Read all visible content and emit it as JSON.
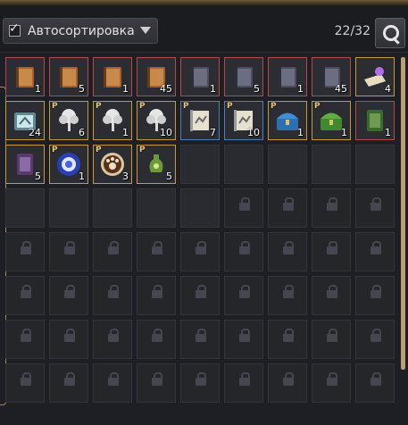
{
  "header": {
    "auto_sort_label": "Автосортировка",
    "auto_sort_checked": true,
    "capacity_text": "22/32"
  },
  "colors": {
    "rare_red": "#b34a4a",
    "rare_blue": "#4b7fb6",
    "rare_gold": "#c49a3a",
    "scroll_thumb": "#b9a073"
  },
  "items": [
    {
      "icon": "brown-book-icon",
      "qty": "1",
      "rarity": "red",
      "p": false
    },
    {
      "icon": "brown-book-icon",
      "qty": "5",
      "rarity": "red",
      "p": false
    },
    {
      "icon": "brown-book-icon",
      "qty": "1",
      "rarity": "red",
      "p": false
    },
    {
      "icon": "brown-book-icon",
      "qty": "45",
      "rarity": "red",
      "p": false
    },
    {
      "icon": "dark-book-icon",
      "qty": "1",
      "rarity": "red",
      "p": false
    },
    {
      "icon": "dark-book-icon",
      "qty": "5",
      "rarity": "red",
      "p": false
    },
    {
      "icon": "dark-book-icon",
      "qty": "1",
      "rarity": "red",
      "p": false
    },
    {
      "icon": "dark-book-icon",
      "qty": "45",
      "rarity": "red",
      "p": false
    },
    {
      "icon": "purple-orb-scroll-icon",
      "qty": "4",
      "rarity": "gold",
      "p": false
    },
    {
      "icon": "silver-chest-icon",
      "qty": "24",
      "rarity": "gold",
      "p": false
    },
    {
      "icon": "white-tree-icon",
      "qty": "6",
      "rarity": "gold",
      "p": true
    },
    {
      "icon": "white-tree-icon",
      "qty": "1",
      "rarity": "gold",
      "p": true
    },
    {
      "icon": "white-tree-icon",
      "qty": "10",
      "rarity": "gold",
      "p": true
    },
    {
      "icon": "map-scroll-icon",
      "qty": "7",
      "rarity": "blue",
      "p": true
    },
    {
      "icon": "map-scroll-icon",
      "qty": "10",
      "rarity": "blue",
      "p": true
    },
    {
      "icon": "blue-treasure-chest-icon",
      "qty": "1",
      "rarity": "gold",
      "p": true
    },
    {
      "icon": "green-treasure-chest-icon",
      "qty": "1",
      "rarity": "gold",
      "p": true
    },
    {
      "icon": "green-tome-icon",
      "qty": "1",
      "rarity": "red",
      "p": false
    },
    {
      "icon": "purple-tome-icon",
      "qty": "5",
      "rarity": "gold",
      "p": false
    },
    {
      "icon": "blue-rune-orb-icon",
      "qty": "1",
      "rarity": "gold",
      "p": true
    },
    {
      "icon": "paw-coin-icon",
      "qty": "3",
      "rarity": "gold",
      "p": true
    },
    {
      "icon": "green-vase-icon",
      "qty": "5",
      "rarity": "gold",
      "p": true
    }
  ]
}
